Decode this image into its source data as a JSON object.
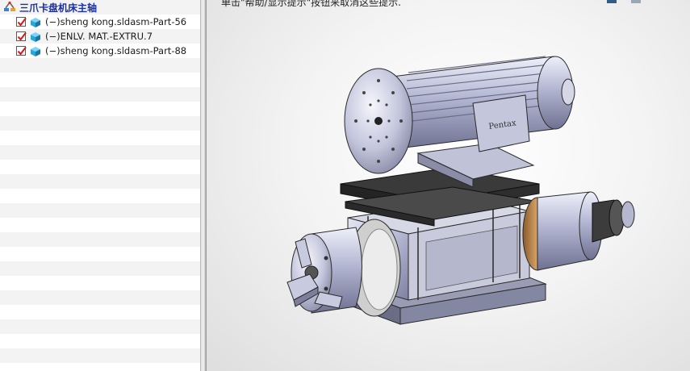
{
  "feature_tree": {
    "root_label": "三爪卡盘机床主轴",
    "items": [
      {
        "label": "(−)sheng kong.sldasm-Part-56",
        "checked": true
      },
      {
        "label": "(−)ENLV. MAT.-EXTRU.7",
        "checked": true
      },
      {
        "label": "(−)sheng kong.sldasm-Part-88",
        "checked": true
      }
    ]
  },
  "viewport": {
    "hint_text": "单击\"帮助/显示提示\"按钮来取消这些提示.",
    "motor_plate_text": "Pentax"
  },
  "colors": {
    "root_label": "#1a2fa8",
    "part_icon": "#2aa7d6",
    "checkmark": "#d11a1a",
    "model_body": "#b9bcd6",
    "model_dark": "#2a2a2a"
  }
}
